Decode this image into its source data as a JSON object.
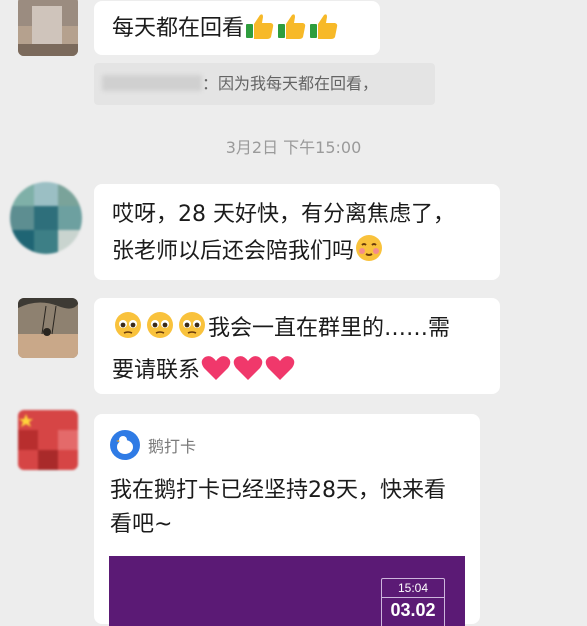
{
  "messages": [
    {
      "text": "每天都在回看"
    },
    {
      "text": "哎呀，28 天好快，有分离焦虑了，\n张老师以后还会陪我们吗"
    },
    {
      "text": "我会一直在群里的……需\n要请联系"
    }
  ],
  "quote": {
    "text": "：因为我每天都在回看，"
  },
  "timestamp": "3月2日 下午15:00",
  "card": {
    "app_name": "鹅打卡",
    "text": "我在鹅打卡已经坚持28天，快来看看吧~",
    "preview_time": "15:04",
    "preview_date": "03.02"
  },
  "colors": {
    "background": "#ededed",
    "bubble": "#ffffff",
    "card_preview": "#5b1a75"
  }
}
